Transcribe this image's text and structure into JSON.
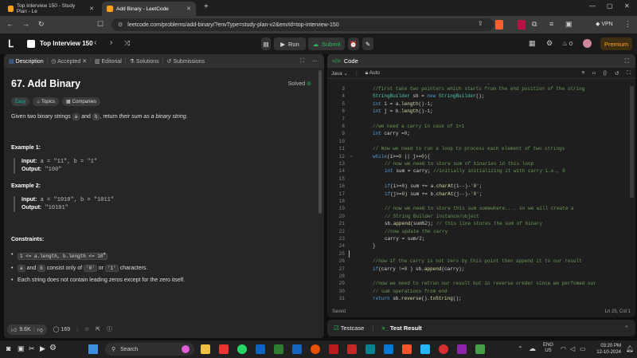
{
  "browser": {
    "tabs": [
      {
        "label": "Top Interview 150 - Study Plan - Le"
      },
      {
        "label": "Add Binary - LeetCode"
      }
    ],
    "url": "leetcode.com/problems/add-binary/?envType=study-plan-v2&envId=top-interview-150",
    "vpn_label": "VPN"
  },
  "lc_nav": {
    "list_title": "Top Interview 150",
    "run_label": "Run",
    "submit_label": "Submit",
    "streak_count": "0",
    "premium_label": "Premium"
  },
  "left": {
    "tabs": [
      "Description",
      "Accepted",
      "Editorial",
      "Solutions",
      "Submissions"
    ],
    "title": "67. Add Binary",
    "solved": "Solved",
    "tags": [
      "Easy",
      "Topics",
      "Companies"
    ],
    "desc_pre": "Given two binary strings ",
    "desc_a": "a",
    "desc_and": " and ",
    "desc_b": "b",
    "desc_post": ", return ",
    "desc_em": "their sum as a binary string",
    "desc_end": ".",
    "ex1_title": "Example 1:",
    "ex1_input_label": "Input:",
    "ex1_input": "a = \"11\", b = \"1\"",
    "ex1_output_label": "Output:",
    "ex1_output": "\"100\"",
    "ex2_title": "Example 2:",
    "ex2_input_label": "Input:",
    "ex2_input": "a = \"1010\", b = \"1011\"",
    "ex2_output_label": "Output:",
    "ex2_output": "\"10101\"",
    "constraints_title": "Constraints:",
    "c1": "1 <= a.length, b.length <= 10",
    "c1_sup": "4",
    "c2_a": "a",
    "c2_and": " and ",
    "c2_b": "b",
    "c2_mid": " consist only of ",
    "c2_0": "'0'",
    "c2_or": " or ",
    "c2_1": "'1'",
    "c2_end": " characters.",
    "c3": "Each string does not contain leading zeros except for the zero itself.",
    "likes": "9.6K",
    "comments": "169"
  },
  "right": {
    "tab": "Code",
    "language": "Java",
    "auto": "Auto",
    "saved": "Saved",
    "cursor": "Ln 25, Col 1",
    "lines": [
      {
        "n": "3",
        "t": "//first take two pointers which starts from the end position of the string",
        "c": "cmt",
        "i": 0
      },
      {
        "n": "4",
        "t": "StringBuilder sb = new StringBuilder();",
        "c": "code",
        "i": 0
      },
      {
        "n": "5",
        "t": "int i = a.length()-1;",
        "c": "code",
        "i": 0
      },
      {
        "n": "6",
        "t": "int j = b.length()-1;",
        "c": "code",
        "i": 0
      },
      {
        "n": "7",
        "t": "",
        "c": "code",
        "i": 0
      },
      {
        "n": "8",
        "t": "//we need a carry in case of 1+1",
        "c": "cmt",
        "i": 0
      },
      {
        "n": "9",
        "t": "int carry =0;",
        "c": "code",
        "i": 0
      },
      {
        "n": "10",
        "t": "",
        "c": "code",
        "i": 0
      },
      {
        "n": "11",
        "t": "// Now we need to run a loop to process each element of two strings",
        "c": "cmt",
        "i": 0
      },
      {
        "n": "12",
        "t": "while(i>=0 || j>=0){",
        "c": "code",
        "i": 0
      },
      {
        "n": "13",
        "t": "// now we need to store sum of binaries in this loop",
        "c": "cmt",
        "i": 1
      },
      {
        "n": "14",
        "t": "int sum = carry; //initially initializing it with carry i.e., 0",
        "c": "code",
        "i": 1
      },
      {
        "n": "15",
        "t": "",
        "c": "code",
        "i": 0
      },
      {
        "n": "16",
        "t": "if(i>=0) sum += a.charAt(i--)-'0';",
        "c": "code",
        "i": 1
      },
      {
        "n": "17",
        "t": "if(j>=0) sum += b.charAt(j--)-'0';",
        "c": "code",
        "i": 1
      },
      {
        "n": "18",
        "t": "",
        "c": "code",
        "i": 0
      },
      {
        "n": "19",
        "t": "// now we need to store this sum somewhere.... so we will create a",
        "c": "cmt",
        "i": 1
      },
      {
        "n": "20",
        "t": "// String Builder instance/object",
        "c": "cmt",
        "i": 1
      },
      {
        "n": "21",
        "t": "sb.append(sum%2); // this line stores the sum of binary",
        "c": "code",
        "i": 1
      },
      {
        "n": "22",
        "t": "//now update the carry",
        "c": "cmt",
        "i": 1
      },
      {
        "n": "23",
        "t": "carry = sum/2;",
        "c": "code",
        "i": 1
      },
      {
        "n": "24",
        "t": "}",
        "c": "code",
        "i": 0
      },
      {
        "n": "25",
        "t": "",
        "c": "code",
        "i": 0
      },
      {
        "n": "26",
        "t": "//now if the carry is not zero by this point then append it to our result",
        "c": "cmt",
        "i": 0
      },
      {
        "n": "27",
        "t": "if(carry !=0 ) sb.append(carry);",
        "c": "code",
        "i": 0
      },
      {
        "n": "28",
        "t": "",
        "c": "code",
        "i": 0
      },
      {
        "n": "29",
        "t": "//now we need to retrun our result but in reverse oreder since we perfomed our",
        "c": "cmt",
        "i": 0
      },
      {
        "n": "30",
        "t": "// sum operations from end",
        "c": "cmt",
        "i": 0
      },
      {
        "n": "31",
        "t": "return sb.reverse().toString();",
        "c": "code",
        "i": 0
      }
    ]
  },
  "bottom": {
    "testcase": "Testcase",
    "result": "Test Result"
  },
  "taskbar": {
    "search": "Search",
    "lang": "ENG",
    "region": "US",
    "time": "03:20 PM",
    "date": "12-10-2024"
  },
  "colors": {
    "accent": "#ffa116",
    "easy": "#00b8a3",
    "submit": "#2cbb5d"
  }
}
